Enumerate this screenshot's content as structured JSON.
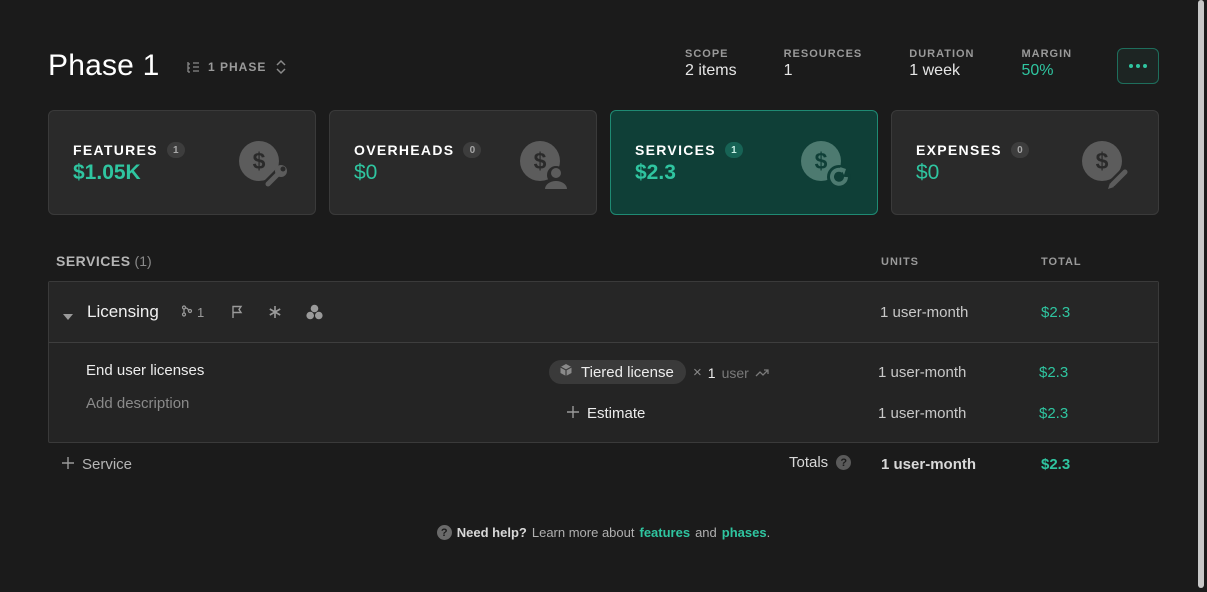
{
  "header": {
    "title": "Phase 1",
    "phase_selector": "1 PHASE",
    "stats": [
      {
        "label": "SCOPE",
        "value": "2 items"
      },
      {
        "label": "RESOURCES",
        "value": "1"
      },
      {
        "label": "DURATION",
        "value": "1 week"
      },
      {
        "label": "MARGIN",
        "value": "50%"
      }
    ],
    "more_icon": "ellipsis-icon"
  },
  "cards": [
    {
      "title": "FEATURES",
      "count": "1",
      "value": "$1.05K",
      "icon": "dollar-wrench-icon"
    },
    {
      "title": "OVERHEADS",
      "count": "0",
      "value": "$0",
      "icon": "dollar-user-icon"
    },
    {
      "title": "SERVICES",
      "count": "1",
      "value": "$2.3",
      "icon": "dollar-refresh-icon",
      "active": true
    },
    {
      "title": "EXPENSES",
      "count": "0",
      "value": "$0",
      "icon": "dollar-pencil-icon"
    }
  ],
  "section": {
    "label": "SERVICES",
    "count": "(1)",
    "col_units": "UNITS",
    "col_total": "TOTAL"
  },
  "service": {
    "name": "Licensing",
    "link_count": "1",
    "units": "1 user-month",
    "total": "$2.3",
    "line": {
      "name": "End user licenses",
      "description_placeholder": "Add description",
      "chip": "Tiered license",
      "times": "×",
      "quantity": "1",
      "unit": "user",
      "units": "1 user-month",
      "total": "$2.3"
    },
    "estimate": {
      "label": "Estimate",
      "units": "1 user-month",
      "total": "$2.3"
    }
  },
  "totals": {
    "add_service": "Service",
    "label": "Totals",
    "units": "1 user-month",
    "total": "$2.3"
  },
  "footer": {
    "help": "Need help?",
    "text1": "Learn more about",
    "link1": "features",
    "and": "and",
    "link2": "phases",
    "period": "."
  },
  "colors": {
    "accent": "#2fc5a0",
    "active_card": "#0f3f37",
    "background": "#1b1b1b"
  }
}
